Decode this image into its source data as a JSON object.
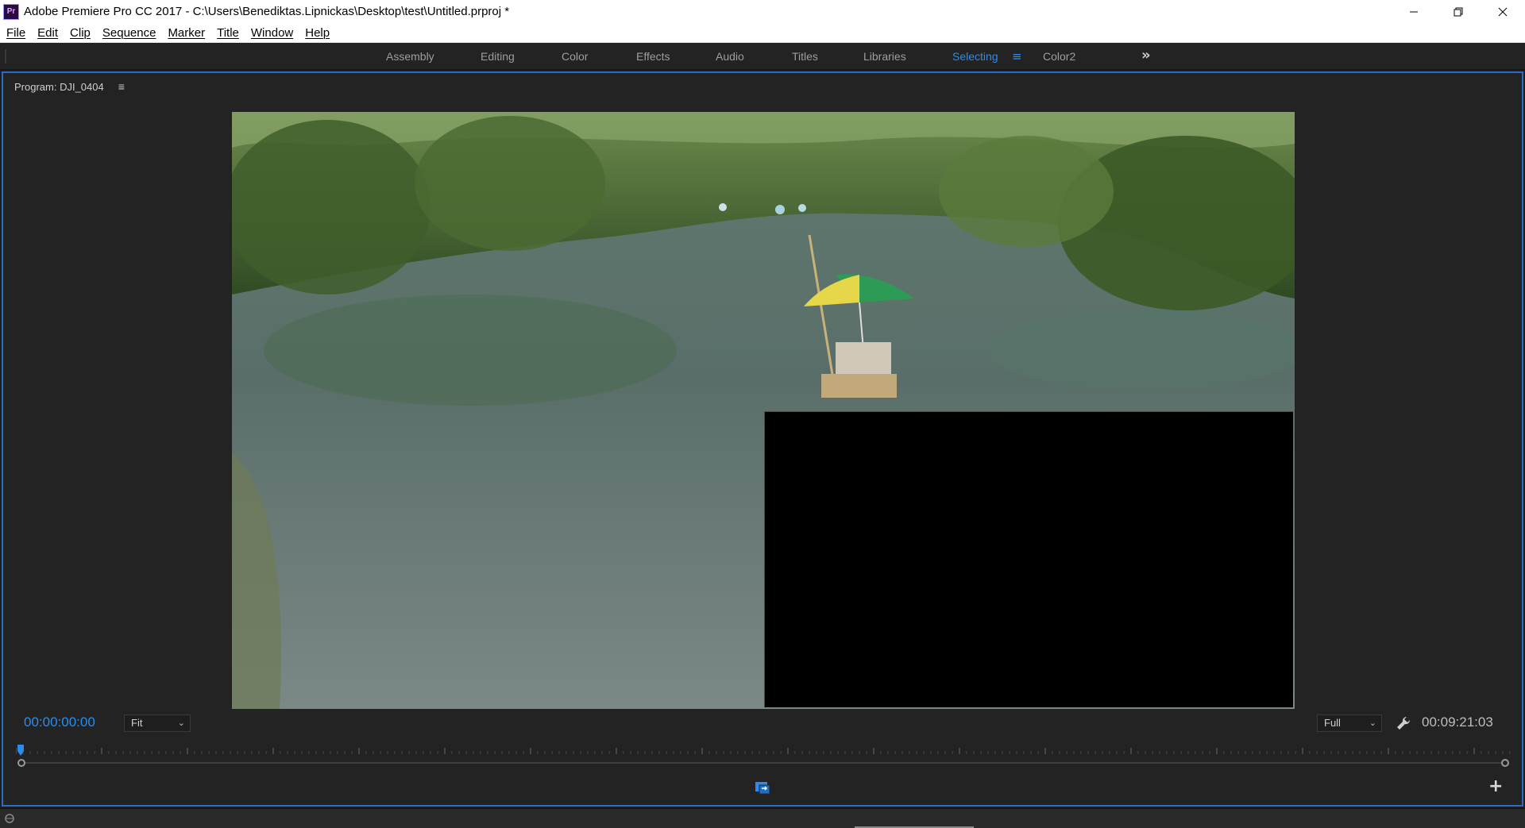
{
  "window": {
    "app_icon": "Pr",
    "title": "Adobe Premiere Pro CC 2017 - C:\\Users\\Benediktas.Lipnickas\\Desktop\\test\\Untitled.prproj *",
    "controls": [
      "minimize-icon",
      "restore-icon",
      "close-icon"
    ]
  },
  "menu": {
    "items": [
      "File",
      "Edit",
      "Clip",
      "Sequence",
      "Marker",
      "Title",
      "Window",
      "Help"
    ]
  },
  "workspaces": {
    "tabs": [
      "Assembly",
      "Editing",
      "Color",
      "Effects",
      "Audio",
      "Titles",
      "Libraries",
      "Selecting",
      "Color2"
    ],
    "active": "Selecting",
    "accent_color": "#2d8ceb"
  },
  "program_monitor": {
    "title": "Program: DJI_0404",
    "menu_icon": "hamburger-icon",
    "current_time": "00:00:00:00",
    "zoom": "Fit",
    "resolution": "Full",
    "duration": "00:09:21:03",
    "settings_icon": "wrench-icon",
    "export_icon": "export-frame-icon",
    "add_icon": "plus-icon"
  }
}
